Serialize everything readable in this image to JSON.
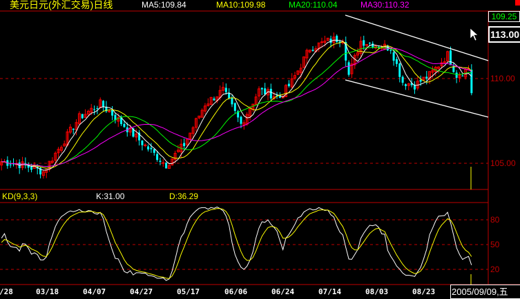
{
  "header": {
    "title": "美元日元(外汇交易)日线",
    "ma5": "MA5:109.84",
    "ma10": "MA10:109.98",
    "ma20": "MA20:110.04",
    "ma30": "MA30:110.32"
  },
  "right_panel": {
    "last_price": "109.25",
    "cursor_price": "113.00",
    "date_readout": "2005/09/09,五"
  },
  "price_axis": {
    "labels": [
      "110.00",
      "105.00"
    ],
    "values": [
      110,
      105
    ]
  },
  "kd": {
    "label": "KD(9,3,3)",
    "k": "K:31.00",
    "d": "D:36.29",
    "axis_labels": [
      "80",
      "50",
      "20"
    ],
    "axis_values": [
      80,
      50,
      20
    ]
  },
  "dates": [
    "/28",
    "03/18",
    "04/07",
    "04/27",
    "05/17",
    "06/06",
    "06/24",
    "07/14",
    "08/03",
    "08/23"
  ],
  "colors": {
    "up": "#ff0000",
    "down": "#00ffff",
    "ma5": "#ffffff",
    "ma10": "#ffff00",
    "ma20": "#00ff00",
    "ma30": "#ff00ff",
    "grid": "#c00000"
  },
  "chart_data": {
    "type": "candlestick",
    "candles": 158,
    "close_keypoints": [
      [
        0,
        105.1
      ],
      [
        7,
        104.9
      ],
      [
        14,
        104.5
      ],
      [
        20,
        106.1
      ],
      [
        26,
        107.7
      ],
      [
        33,
        108.5
      ],
      [
        37,
        107.9
      ],
      [
        44,
        106.7
      ],
      [
        50,
        105.7
      ],
      [
        55,
        104.9
      ],
      [
        61,
        106.1
      ],
      [
        68,
        108.5
      ],
      [
        74,
        109.3
      ],
      [
        80,
        107.3
      ],
      [
        86,
        109.3
      ],
      [
        93,
        108.9
      ],
      [
        97,
        109.8
      ],
      [
        103,
        111.8
      ],
      [
        109,
        112.2
      ],
      [
        114,
        112.4
      ],
      [
        116,
        110.2
      ],
      [
        120,
        112.2
      ],
      [
        125,
        112.0
      ],
      [
        130,
        111.8
      ],
      [
        134,
        109.8
      ],
      [
        138,
        109.6
      ],
      [
        143,
        110.2
      ],
      [
        149,
        111.4
      ],
      [
        152,
        110.2
      ],
      [
        156,
        110.6
      ],
      [
        157,
        109.2
      ]
    ]
  }
}
